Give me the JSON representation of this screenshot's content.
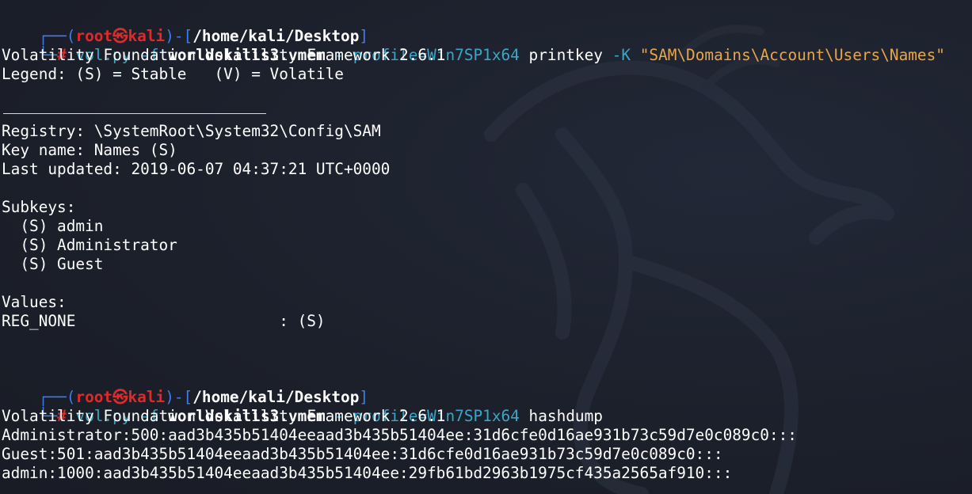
{
  "prompt1": {
    "corner": "┌──(",
    "user": "root㉿kali",
    "mid": ")-[",
    "path": "/home/kali/Desktop",
    "end": "]",
    "hash_corner": "└─",
    "hash": "#",
    "cmd": "vol.py",
    "flag_f": "-f",
    "file": "worldskills3.vmem",
    "profile": "--profile=Win7SP1x64",
    "plugin": "printkey",
    "flag_k": "-K",
    "key_arg": "\"SAM\\Domains\\Account\\Users\\Names\""
  },
  "output1": {
    "line1": "Volatility Foundation Volatility Framework 2.6.1",
    "line2": "Legend: (S) = Stable   (V) = Volatile",
    "registry": "Registry: \\SystemRoot\\System32\\Config\\SAM",
    "key_name": "Key name: Names (S)",
    "last_updated": "Last updated: 2019-06-07 04:37:21 UTC+0000",
    "subkeys_header": "Subkeys:",
    "subkeys": [
      "  (S) admin",
      "  (S) Administrator",
      "  (S) Guest"
    ],
    "values_header": "Values:",
    "values_row": "REG_NONE                      : (S)"
  },
  "prompt2": {
    "corner": "┌──(",
    "user": "root㉿kali",
    "mid": ")-[",
    "path": "/home/kali/Desktop",
    "end": "]",
    "hash_corner": "└─",
    "hash": "#",
    "cmd": "vol.py",
    "flag_f": "-f",
    "file": "worldskills3.vmem",
    "profile": "--profile=Win7SP1x64",
    "plugin": "hashdump"
  },
  "output2": {
    "line1": "Volatility Foundation Volatility Framework 2.6.1",
    "hashes": [
      "Administrator:500:aad3b435b51404eeaad3b435b51404ee:31d6cfe0d16ae931b73c59d7e0c089c0:::",
      "Guest:501:aad3b435b51404eeaad3b435b51404ee:31d6cfe0d16ae931b73c59d7e0c089c0:::",
      "admin:1000:aad3b435b51404eeaad3b435b51404ee:29fb61bd2963b1975cf435a2565af910:::"
    ]
  },
  "icons": {
    "background": "kali-dragon-icon"
  },
  "colors": {
    "background": "#1b1f2a",
    "prompt_blue": "#3d7dea",
    "user_red": "#e02a2a",
    "command_cyan": "#3aa6c9",
    "string_orange": "#e8a64a"
  }
}
